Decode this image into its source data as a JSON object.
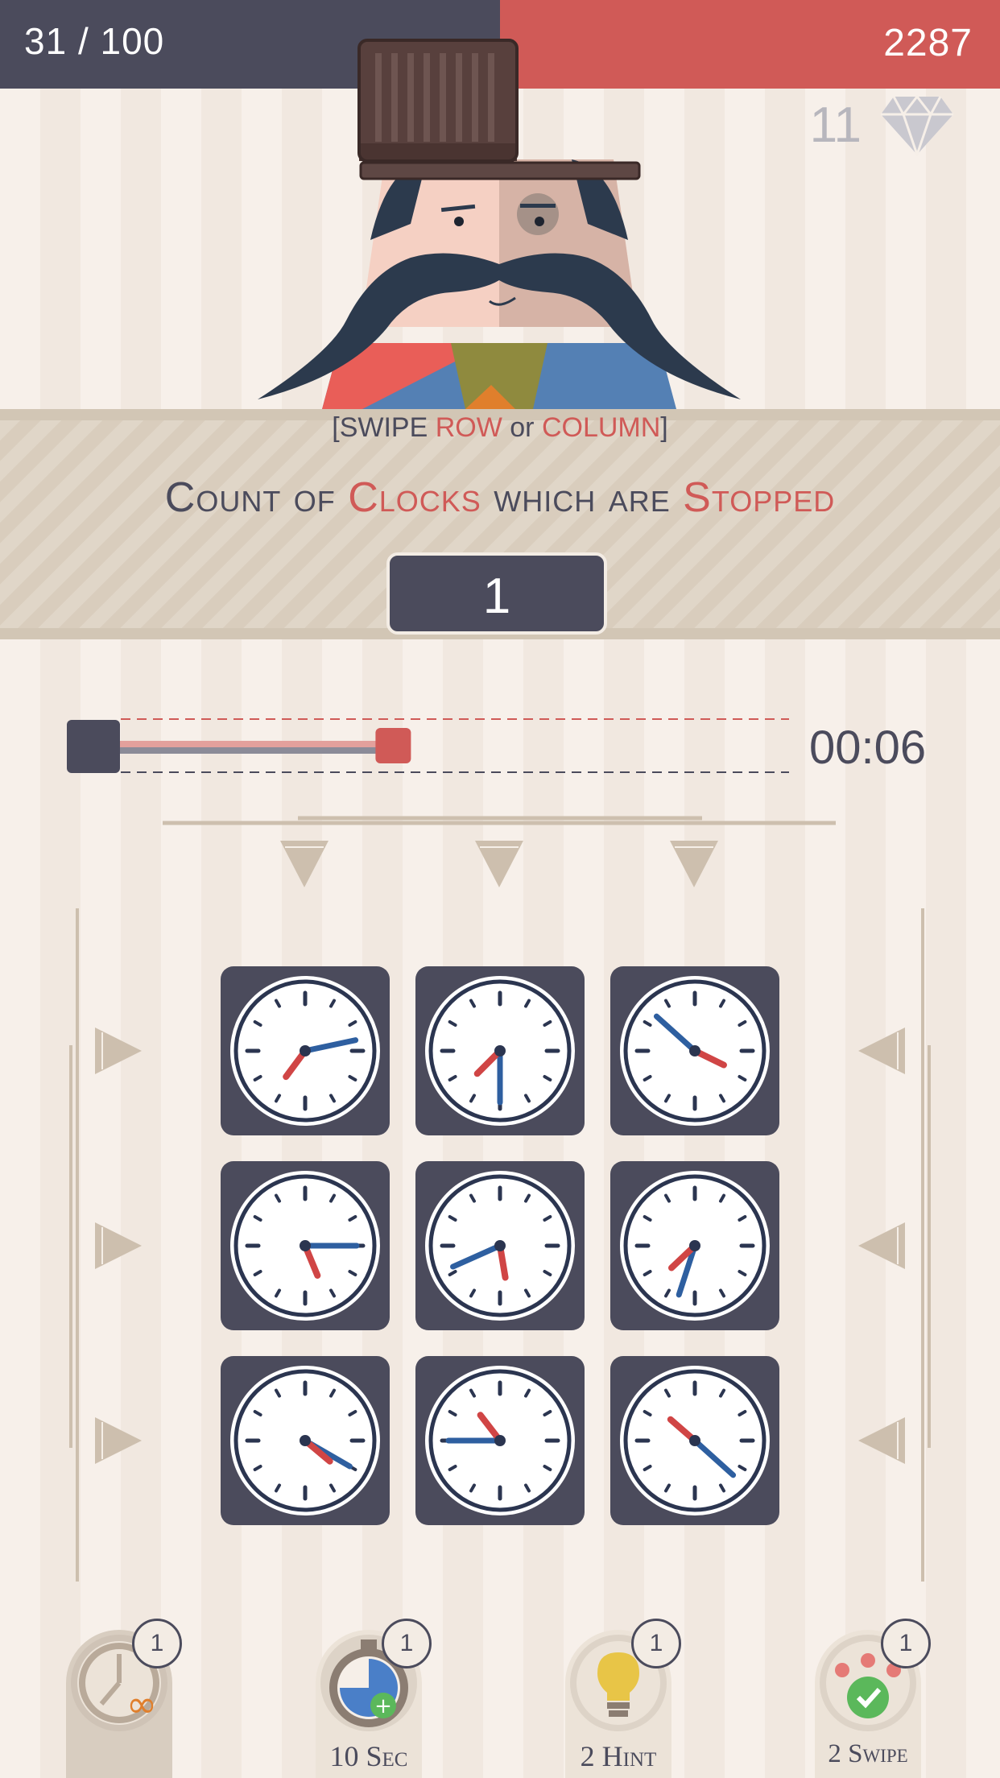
{
  "header": {
    "level_progress": "31 / 100",
    "score": "2287",
    "gems": "11"
  },
  "instruction": {
    "bracket_open": "[",
    "swipe": "SWIPE",
    "row": "ROW",
    "or": "or",
    "column": "COLUMN",
    "bracket_close": "]"
  },
  "question": {
    "part1": "Count of",
    "part2": "Clocks",
    "part3": "which are",
    "part4": "Stopped"
  },
  "answer": "1",
  "timer": {
    "time": "00:06",
    "progress": 0.67
  },
  "clocks": [
    {
      "hour": 7,
      "minute": 13
    },
    {
      "hour": 7,
      "minute": 30
    },
    {
      "hour": 3,
      "minute": 52
    },
    {
      "hour": 5,
      "minute": 15
    },
    {
      "hour": 5,
      "minute": 41
    },
    {
      "hour": 7,
      "minute": 33
    },
    {
      "hour": 4,
      "minute": 20
    },
    {
      "hour": 10,
      "minute": 45
    },
    {
      "hour": 10,
      "minute": 22
    }
  ],
  "powerups": [
    {
      "label": "",
      "count": "1",
      "icon": "infinite-time-icon"
    },
    {
      "label": "10 Sec",
      "count": "1",
      "icon": "stopwatch-plus-icon"
    },
    {
      "label": "2 Hint",
      "count": "1",
      "icon": "lightbulb-icon"
    },
    {
      "label": "2 Swipe",
      "count": "1",
      "icon": "swipe-check-icon"
    }
  ],
  "colors": {
    "dark": "#4b4b5c",
    "accent": "#d05a57",
    "minute_hand": "#2e5fa0",
    "hour_hand": "#d04545"
  }
}
